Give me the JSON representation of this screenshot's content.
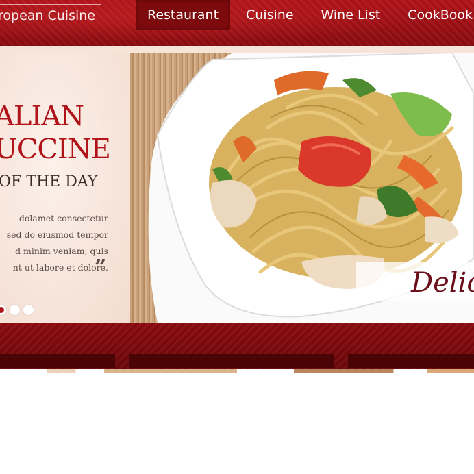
{
  "header": {
    "brand": "ropean Cuisine",
    "nav": [
      {
        "label": "Restaurant",
        "active": true
      },
      {
        "label": "Cuisine",
        "active": false
      },
      {
        "label": "Wine List",
        "active": false
      },
      {
        "label": "CookBook",
        "active": false
      }
    ]
  },
  "slide": {
    "headline_line1": "ALIAN",
    "headline_line2": "UCCINE",
    "subheading": "OF THE DAY",
    "blurb_lines": [
      "dolamet consectetur",
      "sed do eiusmod tempor",
      "d minim veniam, quis",
      "nt ut labore et dolore."
    ],
    "quote_mark": "”",
    "photo_caption": "Delici",
    "dots": [
      {
        "active": true
      },
      {
        "active": false
      },
      {
        "active": false
      }
    ]
  },
  "colors": {
    "brand_red": "#b0141a",
    "header_red": "#a51016",
    "dark_red": "#7d0a0d",
    "cream": "#f7e4d8"
  },
  "icons": {
    "quote": "closing-quote-icon"
  }
}
